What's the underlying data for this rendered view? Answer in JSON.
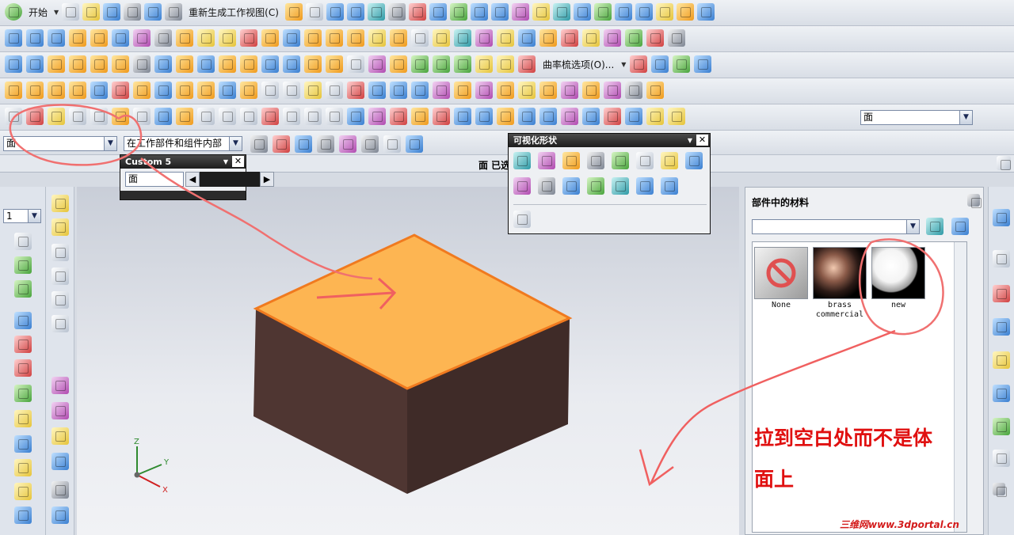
{
  "toolbar": {
    "start_label": "开始",
    "regenerate_label": "重新生成工作视图(C)",
    "curvature_options_label": "曲率梳选项(O)...",
    "right_type_filter": "面"
  },
  "selection_bar": {
    "type_filter": "面",
    "scope": "在工作部件和组件内部"
  },
  "status": {
    "message": "面 已选"
  },
  "custom_panel": {
    "title": "Custom 5",
    "field_value": "面"
  },
  "visual_panel": {
    "title": "可视化形状"
  },
  "materials_panel": {
    "title": "部件中的材料",
    "search_value": "",
    "materials": [
      {
        "name": "None"
      },
      {
        "name": "brass commercial"
      },
      {
        "name": "new"
      }
    ]
  },
  "left_toolbar": {
    "layer_value": "1"
  },
  "triad": {
    "z": "Z",
    "y": "Y",
    "x": "X"
  },
  "annotation": {
    "line1": "拉到空白处而不是体",
    "line2": "面上"
  },
  "watermark": "三维网www.3dportal.cn",
  "colors": {
    "top_face": "#fdb552",
    "top_edge": "#f07a1f",
    "side_face": "#4a3430",
    "annotation": "#e01010"
  }
}
